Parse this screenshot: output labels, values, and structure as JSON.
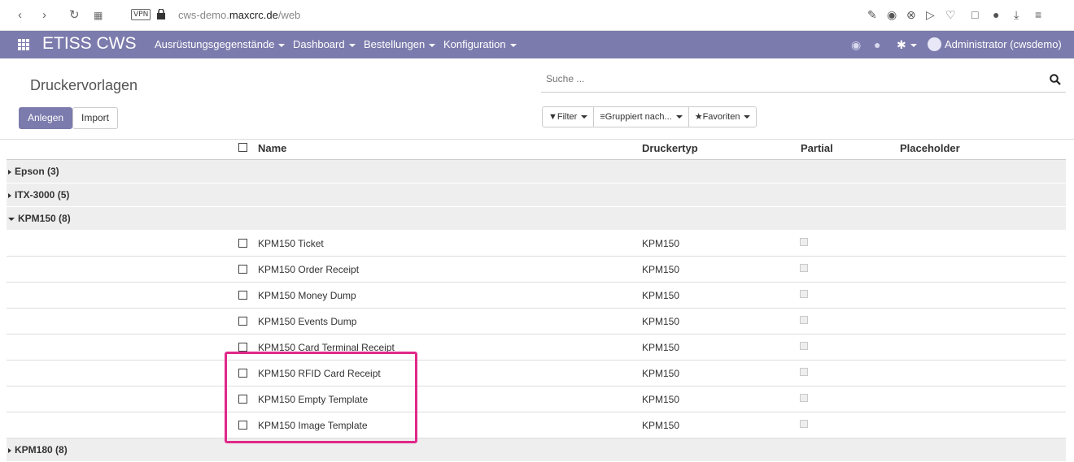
{
  "browser": {
    "vpn": "VPN",
    "url_prefix": "cws-demo.",
    "url_host": "maxcrc.de",
    "url_path": "/web"
  },
  "navbar": {
    "brand": "ETISS CWS",
    "menus": [
      "Ausrüstungsgegenstände",
      "Dashboard",
      "Bestellungen",
      "Konfiguration"
    ],
    "user": "Administrator (cwsdemo)"
  },
  "control_panel": {
    "breadcrumb": "Druckervorlagen",
    "search_placeholder": "Suche ...",
    "create_label": "Anlegen",
    "import_label": "Import",
    "filter_label": "Filter",
    "groupby_label": "Gruppiert nach...",
    "favorites_label": "Favoriten"
  },
  "table": {
    "headers": {
      "name": "Name",
      "type": "Druckertyp",
      "partial": "Partial",
      "placeholder": "Placeholder"
    },
    "groups": [
      {
        "label": "Epson (3)"
      },
      {
        "label": "ITX-3000 (5)"
      },
      {
        "label": "KPM150 (8)"
      },
      {
        "label": "KPM180 (8)"
      }
    ],
    "rows": [
      {
        "name": "KPM150 Ticket",
        "type": "KPM150"
      },
      {
        "name": "KPM150 Order Receipt",
        "type": "KPM150"
      },
      {
        "name": "KPM150 Money Dump",
        "type": "KPM150"
      },
      {
        "name": "KPM150 Events Dump",
        "type": "KPM150"
      },
      {
        "name": "KPM150 Card Terminal Receipt",
        "type": "KPM150"
      },
      {
        "name": "KPM150 RFID Card Receipt",
        "type": "KPM150"
      },
      {
        "name": "KPM150 Empty Template",
        "type": "KPM150"
      },
      {
        "name": "KPM150 Image Template",
        "type": "KPM150"
      }
    ]
  },
  "colors": {
    "brand": "#7c7bad",
    "highlight": "#e0288a"
  }
}
